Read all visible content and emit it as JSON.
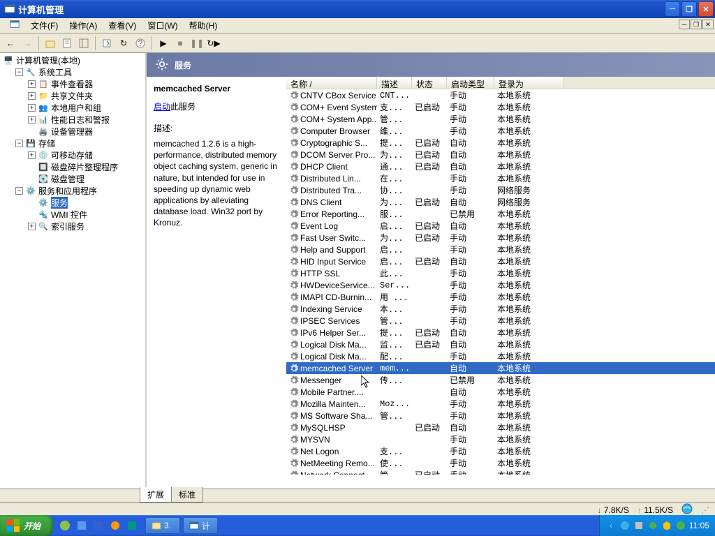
{
  "window": {
    "title": "计算机管理"
  },
  "menu": {
    "file": "文件(F)",
    "action": "操作(A)",
    "view": "查看(V)",
    "window": "窗口(W)",
    "help": "帮助(H)"
  },
  "tree": {
    "root": "计算机管理(本地)",
    "systools": "系统工具",
    "eventviewer": "事件查看器",
    "shared": "共享文件夹",
    "localusers": "本地用户和组",
    "perflog": "性能日志和警报",
    "devmgr": "设备管理器",
    "storage": "存储",
    "removable": "可移动存储",
    "defrag": "磁盘碎片整理程序",
    "diskmgmt": "磁盘管理",
    "svcapps": "服务和应用程序",
    "services": "服务",
    "wmi": "WMI 控件",
    "indexsvc": "索引服务"
  },
  "header": {
    "title": "服务"
  },
  "detail": {
    "serviceName": "memcached Server",
    "startLink": "启动",
    "startSuffix": "此服务",
    "descLabel": "描述:",
    "descBody": "memcached 1.2.6 is a high-performance, distributed memory object caching system, generic in nature, but intended for use in speeding up dynamic web applications by alleviating database load. Win32 port by Kronuz."
  },
  "columns": {
    "name": "名称 /",
    "desc": "描述",
    "status": "状态",
    "startup": "启动类型",
    "logon": "登录为"
  },
  "tabs": {
    "extended": "扩展",
    "standard": "标准"
  },
  "status": {
    "down": "7.8K/S",
    "up": "11.5K/S"
  },
  "taskbar": {
    "start": "开始",
    "task1": "3.",
    "task2": "计",
    "time": "11:05"
  },
  "services": [
    {
      "name": "CNTV CBox Service",
      "desc": "CNT...",
      "status": "",
      "startup": "手动",
      "logon": "本地系统"
    },
    {
      "name": "COM+ Event System",
      "desc": "支...",
      "status": "已启动",
      "startup": "手动",
      "logon": "本地系统"
    },
    {
      "name": "COM+ System App...",
      "desc": "管...",
      "status": "",
      "startup": "手动",
      "logon": "本地系统"
    },
    {
      "name": "Computer Browser",
      "desc": "维...",
      "status": "",
      "startup": "手动",
      "logon": "本地系统"
    },
    {
      "name": "Cryptographic S...",
      "desc": "提...",
      "status": "已启动",
      "startup": "自动",
      "logon": "本地系统"
    },
    {
      "name": "DCOM Server Pro...",
      "desc": "为...",
      "status": "已启动",
      "startup": "自动",
      "logon": "本地系统"
    },
    {
      "name": "DHCP Client",
      "desc": "通...",
      "status": "已启动",
      "startup": "自动",
      "logon": "本地系统"
    },
    {
      "name": "Distributed Lin...",
      "desc": "在...",
      "status": "",
      "startup": "手动",
      "logon": "本地系统"
    },
    {
      "name": "Distributed Tra...",
      "desc": "协...",
      "status": "",
      "startup": "手动",
      "logon": "网络服务"
    },
    {
      "name": "DNS Client",
      "desc": "为...",
      "status": "已启动",
      "startup": "自动",
      "logon": "网络服务"
    },
    {
      "name": "Error Reporting...",
      "desc": "服...",
      "status": "",
      "startup": "已禁用",
      "logon": "本地系统"
    },
    {
      "name": "Event Log",
      "desc": "启...",
      "status": "已启动",
      "startup": "自动",
      "logon": "本地系统"
    },
    {
      "name": "Fast User Switc...",
      "desc": "为...",
      "status": "已启动",
      "startup": "手动",
      "logon": "本地系统"
    },
    {
      "name": "Help and Support",
      "desc": "启...",
      "status": "",
      "startup": "手动",
      "logon": "本地系统"
    },
    {
      "name": "HID Input Service",
      "desc": "启...",
      "status": "已启动",
      "startup": "自动",
      "logon": "本地系统"
    },
    {
      "name": "HTTP SSL",
      "desc": "此...",
      "status": "",
      "startup": "手动",
      "logon": "本地系统"
    },
    {
      "name": "HWDeviceService...",
      "desc": "Ser...",
      "status": "",
      "startup": "手动",
      "logon": "本地系统"
    },
    {
      "name": "IMAPI CD-Burnin...",
      "desc": "用 ...",
      "status": "",
      "startup": "手动",
      "logon": "本地系统"
    },
    {
      "name": "Indexing Service",
      "desc": "本...",
      "status": "",
      "startup": "手动",
      "logon": "本地系统"
    },
    {
      "name": "IPSEC Services",
      "desc": "管...",
      "status": "",
      "startup": "手动",
      "logon": "本地系统"
    },
    {
      "name": "IPv6 Helper Ser...",
      "desc": "提...",
      "status": "已启动",
      "startup": "自动",
      "logon": "本地系统"
    },
    {
      "name": "Logical Disk Ma...",
      "desc": "监...",
      "status": "已启动",
      "startup": "自动",
      "logon": "本地系统"
    },
    {
      "name": "Logical Disk Ma...",
      "desc": "配...",
      "status": "",
      "startup": "手动",
      "logon": "本地系统"
    },
    {
      "name": "memcached Server",
      "desc": "mem...",
      "status": "",
      "startup": "自动",
      "logon": "本地系统",
      "selected": true
    },
    {
      "name": "Messenger",
      "desc": "传...",
      "status": "",
      "startup": "已禁用",
      "logon": "本地系统"
    },
    {
      "name": "Mobile Partner....",
      "desc": "",
      "status": "",
      "startup": "自动",
      "logon": "本地系统"
    },
    {
      "name": "Mozilla Mainten...",
      "desc": "Moz...",
      "status": "",
      "startup": "手动",
      "logon": "本地系统"
    },
    {
      "name": "MS Software Sha...",
      "desc": "管...",
      "status": "",
      "startup": "手动",
      "logon": "本地系统"
    },
    {
      "name": "MySQLHSP",
      "desc": "",
      "status": "已启动",
      "startup": "自动",
      "logon": "本地系统"
    },
    {
      "name": "MYSVN",
      "desc": "",
      "status": "",
      "startup": "手动",
      "logon": "本地系统"
    },
    {
      "name": "Net Logon",
      "desc": "支...",
      "status": "",
      "startup": "手动",
      "logon": "本地系统"
    },
    {
      "name": "NetMeeting Remo...",
      "desc": "使...",
      "status": "",
      "startup": "手动",
      "logon": "本地系统"
    },
    {
      "name": "Network Connect...",
      "desc": "管...",
      "status": "已启动",
      "startup": "手动",
      "logon": "本地系统"
    }
  ]
}
